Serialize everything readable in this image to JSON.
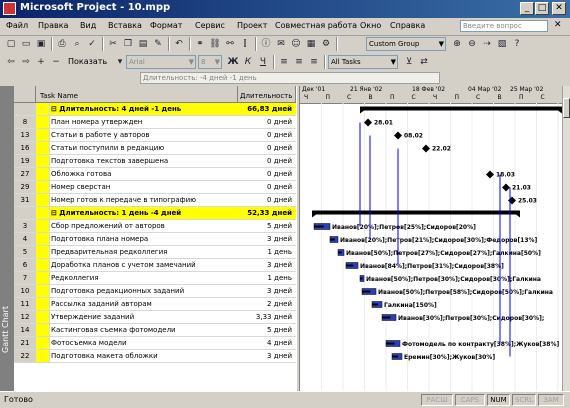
{
  "window": {
    "title": "Microsoft Project - 10.mpp"
  },
  "menu": [
    "Файл",
    "Правка",
    "Вид",
    "Вставка",
    "Формат",
    "Сервис",
    "Проект",
    "Совместная работа",
    "Окно",
    "Справка"
  ],
  "help_placeholder": "Введите вопрос",
  "toolbar": {
    "group_value": "Custom Group",
    "show_label": "Показать",
    "font_value": "Arial",
    "font_size": "8",
    "filter_value": "All Tasks"
  },
  "entry_bar_text": "Длительность: -4 дней -1 день",
  "view_bar_label": "Gantt Chart",
  "table": {
    "col_name": "Task Name",
    "col_duration": "Длительность",
    "rows": [
      {
        "id": "",
        "name": "⊟ Длительность: 4 дней -1 день",
        "duration": "66,83 дней",
        "summary": true
      },
      {
        "id": "8",
        "name": "План номера утвержден",
        "duration": "0 дней"
      },
      {
        "id": "13",
        "name": "Статьи в работе у авторов",
        "duration": "0 дней"
      },
      {
        "id": "16",
        "name": "Статьи поступили в редакцию",
        "duration": "0 дней"
      },
      {
        "id": "19",
        "name": "Подготовка текстов завершена",
        "duration": "0 дней"
      },
      {
        "id": "27",
        "name": "Обложка готова",
        "duration": "0 дней"
      },
      {
        "id": "29",
        "name": "Номер сверстан",
        "duration": "0 дней"
      },
      {
        "id": "31",
        "name": "Номер готов к передаче в типографию",
        "duration": "0 дней"
      },
      {
        "id": "",
        "name": "⊟ Длительность: 1 день -4 дней",
        "duration": "52,33 дней",
        "summary": true
      },
      {
        "id": "3",
        "name": "Сбор предложений от авторов",
        "duration": "5 дней"
      },
      {
        "id": "4",
        "name": "Подготовка плана номера",
        "duration": "3 дней"
      },
      {
        "id": "5",
        "name": "Предварительная редколлегия",
        "duration": "1 день"
      },
      {
        "id": "6",
        "name": "Доработка планов с учетом замечаний",
        "duration": "3 дней"
      },
      {
        "id": "7",
        "name": "Редколлегия",
        "duration": "1 день"
      },
      {
        "id": "10",
        "name": "Подготовка редакционных заданий",
        "duration": "3 дней"
      },
      {
        "id": "11",
        "name": "Рассылка заданий авторам",
        "duration": "2 дней"
      },
      {
        "id": "12",
        "name": "Утверждение заданий",
        "duration": "3,33 дней"
      },
      {
        "id": "14",
        "name": "Кастинговая съемка фотомодели",
        "duration": "5 дней"
      },
      {
        "id": "21",
        "name": "Фотосъемка модели",
        "duration": "4 дней"
      },
      {
        "id": "22",
        "name": "Подготовка макета обложки",
        "duration": "3 дней"
      }
    ]
  },
  "gantt": {
    "months": [
      "Дек '01",
      "21 Янв '02",
      "18 Фев '02",
      "04 Мар '02",
      "25 Мар '02"
    ],
    "days": [
      "Ч",
      "П",
      "С",
      "В",
      "П",
      "С",
      "Ч",
      "П",
      "С",
      "В",
      "П",
      "С"
    ],
    "milestones": [
      "28.01",
      "08.02",
      "22.02",
      "18.03",
      "21.03",
      "25.03"
    ],
    "labels": [
      "Иванов[20%];Петров[25%];Сидоров[20%]",
      "Иванов[20%];Петров[21%];Сидоров[30%];Федоров[13%]",
      "Иванов[50%];Петров[27%];Сидоров[27%];Галкина[50%]",
      "Иванов[84%];Петров[31%];Сидоров[38%]",
      "Иванов[50%];Петров[30%];Сидоров[30%];Галкина",
      "Иванов[50%];Петров[58%];Сидоров[50%];Галкина",
      "Галкина[150%]",
      "Иванов[30%];Петров[30%];Сидоров[30%];",
      "Фотомодель по контракту[38%];Жуков[38%]",
      "Еремин[30%];Жуков[30%]"
    ]
  },
  "status": {
    "text": "Готово",
    "indicators": [
      {
        "label": "РАСШ",
        "on": false
      },
      {
        "label": "CAPS",
        "on": false
      },
      {
        "label": "NUM",
        "on": true
      },
      {
        "label": "SCRL",
        "on": false
      },
      {
        "label": "ЗАМ",
        "on": false
      }
    ]
  }
}
